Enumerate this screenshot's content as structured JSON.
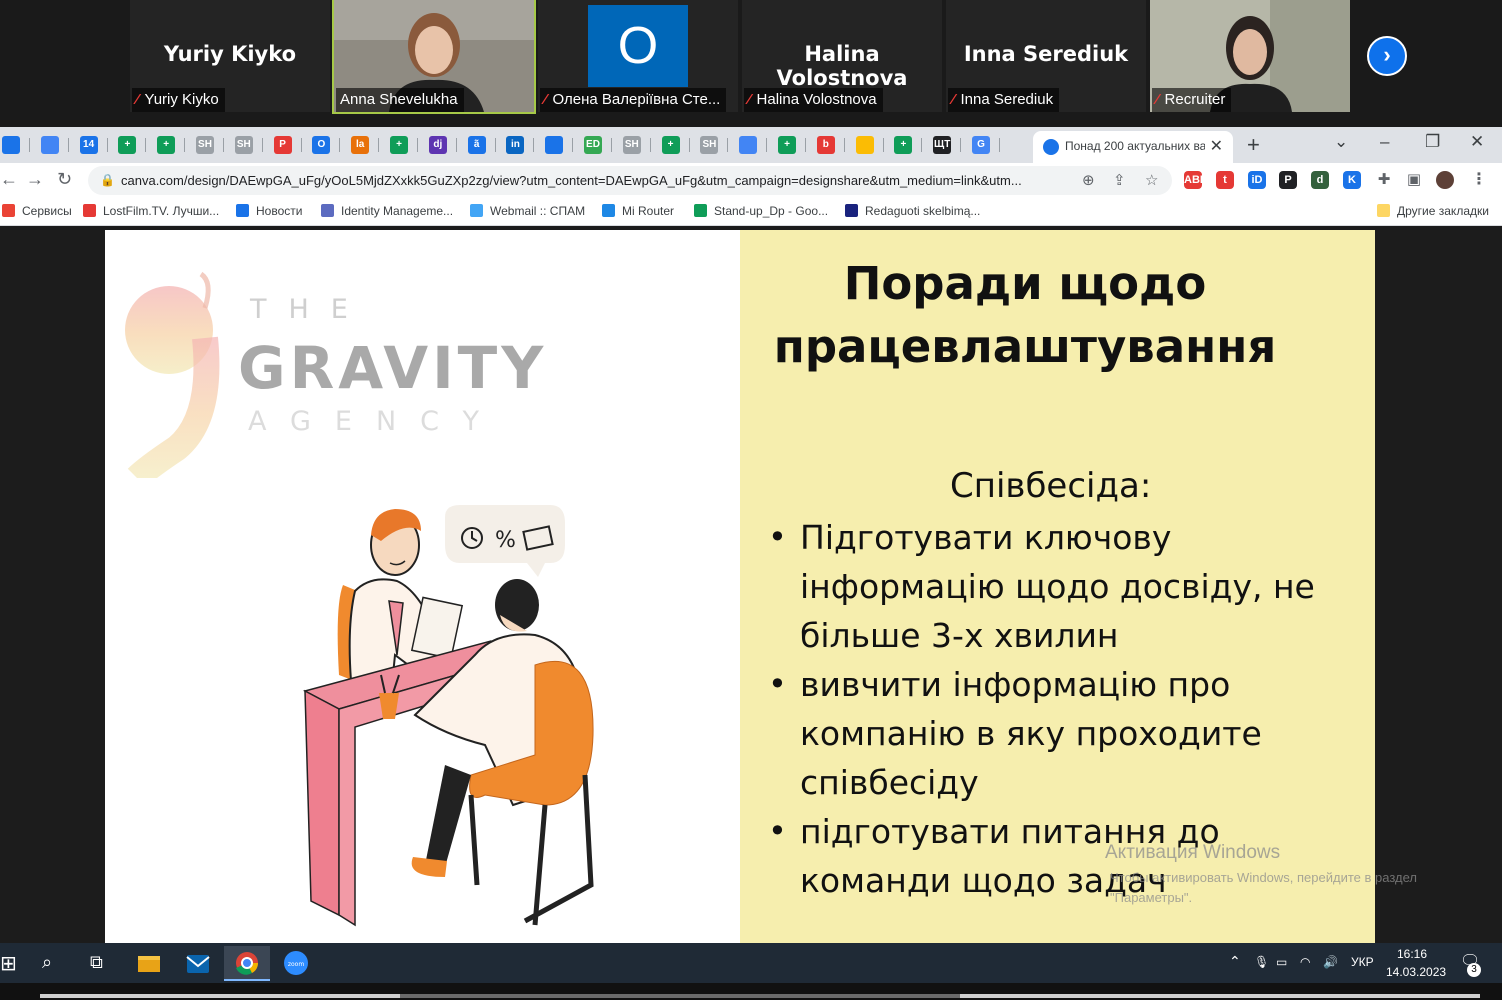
{
  "zoom": {
    "participants": [
      {
        "big_name": "Yuriy Kiyko",
        "label": "Yuriy Kiyko"
      },
      {
        "label": "Anna Shevelukha"
      },
      {
        "avatar_letter": "O",
        "label": "Олена Валеріївна Сте..."
      },
      {
        "big_name": "Halina Volostnova",
        "label": "Halina Volostnova"
      },
      {
        "big_name": "Inna Serediuk",
        "label": "Inna Serediuk"
      },
      {
        "label": "Recruiter"
      }
    ],
    "next_icon": "chevron-right-icon"
  },
  "browser": {
    "active_tab_title": "Понад 200 актуальних ва",
    "url": "canva.com/design/DAEwpGA_uFg/yOoL5MjdZXxkk5GuZXp2zg/view?utm_content=DAEwpGA_uFg&utm_campaign=designshare&utm_medium=link&utm...",
    "tab_icons": [
      {
        "text": "",
        "color": "#1a73e8"
      },
      {
        "text": "",
        "color": "#4285f4"
      },
      {
        "text": "14",
        "color": "#1a73e8"
      },
      {
        "text": "+",
        "color": "#0f9d58"
      },
      {
        "text": "+",
        "color": "#0f9d58"
      },
      {
        "text": "SH",
        "color": "#9aa0a6"
      },
      {
        "text": "SH",
        "color": "#9aa0a6"
      },
      {
        "text": "P",
        "color": "#e53935"
      },
      {
        "text": "O",
        "color": "#1a73e8"
      },
      {
        "text": "la",
        "color": "#e8710a"
      },
      {
        "text": "+",
        "color": "#0f9d58"
      },
      {
        "text": "dj",
        "color": "#5e35b1"
      },
      {
        "text": "ã",
        "color": "#1a73e8"
      },
      {
        "text": "in",
        "color": "#0a66c2"
      },
      {
        "text": "",
        "color": "#1a73e8"
      },
      {
        "text": "ED",
        "color": "#34a853"
      },
      {
        "text": "SH",
        "color": "#9aa0a6"
      },
      {
        "text": "+",
        "color": "#0f9d58"
      },
      {
        "text": "SH",
        "color": "#9aa0a6"
      },
      {
        "text": "",
        "color": "#4285f4"
      },
      {
        "text": "+",
        "color": "#0f9d58"
      },
      {
        "text": "b",
        "color": "#e53935"
      },
      {
        "text": "",
        "color": "#fbbc04"
      },
      {
        "text": "+",
        "color": "#0f9d58"
      },
      {
        "text": "ЩТ",
        "color": "#202124"
      },
      {
        "text": "G",
        "color": "#4285f4"
      }
    ],
    "extensions": [
      {
        "text": "ABP",
        "color": "#e53935"
      },
      {
        "text": "t",
        "color": "#e53935"
      },
      {
        "text": "iD",
        "color": "#1a73e8"
      },
      {
        "text": "P",
        "color": "#202124"
      },
      {
        "text": "d",
        "color": "#34613d"
      },
      {
        "text": "K",
        "color": "#1a73e8"
      }
    ],
    "bookmarks": [
      {
        "label": "Сервисы",
        "color": "#ea4335"
      },
      {
        "label": "LostFilm.TV. Лучши...",
        "color": "#e53935"
      },
      {
        "label": "Новости",
        "color": "#1a73e8"
      },
      {
        "label": "Identity Manageme...",
        "color": "#5c6bc0"
      },
      {
        "label": "Webmail :: СПАМ",
        "color": "#42a5f5"
      },
      {
        "label": "Mi Router",
        "color": "#1e88e5"
      },
      {
        "label": "Stand-up_Dp - Goo...",
        "color": "#0f9d58"
      },
      {
        "label": "Redaguoti skelbimą...",
        "color": "#1a237e"
      }
    ],
    "other_bookmarks": "Другие закладки"
  },
  "slide": {
    "logo": {
      "the": "THE",
      "gravity": "GRAVITY",
      "agency": "AGENCY"
    },
    "title": "Поради щодо працевлаштування",
    "subtitle": "Співбесіда:",
    "bullets": [
      "Підготувати ключову інформацію щодо досвіду, не більше 3-х хвилин",
      "вивчити інформацію про компанію в яку проходите співбесіду",
      "підготувати питання до команди щодо задач"
    ]
  },
  "watermark": {
    "title": "Активация Windows",
    "text": "Чтобы активировать Windows, перейдите в раздел \"Параметры\"."
  },
  "taskbar": {
    "lang": "УКР",
    "time": "16:16",
    "date": "14.03.2023",
    "notifications": "3"
  }
}
